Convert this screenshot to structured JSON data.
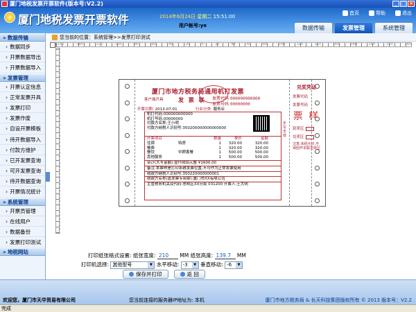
{
  "window": {
    "title": "厦门地税发票开票软件(版本号:V2.2)",
    "min": "_",
    "max": "□",
    "close": "×"
  },
  "header": {
    "app_title": "厦门地税发票开票软件",
    "date": "2014年6月24日",
    "weekday": "星期二",
    "time": "15:51:00",
    "account_label": "用户帐号:ye",
    "links": [
      "首页",
      "帮助",
      "退出"
    ],
    "tabs": [
      "数据传输",
      "发票管理",
      "系统管理"
    ],
    "active_tab": "发票管理"
  },
  "sidebar": {
    "groups": [
      {
        "title": "数据传输",
        "items": [
          "数据同步",
          "开票数据导出",
          "开票数据导入"
        ]
      },
      {
        "title": "发票管理",
        "items": [
          "开票认定信息",
          "正常发票开具",
          "发票打印",
          "发票作废",
          "自设开票模板",
          "待开数据导入",
          "付款方维护",
          "已开发票查询",
          "可开发票查询",
          "待开数据查询",
          "开票情况统计"
        ]
      },
      {
        "title": "系统管理",
        "items": [
          "开票员管理",
          "在线用户",
          "数据备份",
          "发票打印测试"
        ]
      },
      {
        "title": "地税网站",
        "items": []
      }
    ]
  },
  "breadcrumb": "您当前的位置：系统管理>>发票打印测试",
  "ruler": {
    "marks": [
      "-150",
      "-140",
      "-120",
      "-100",
      "-80",
      "-60",
      "-40",
      "-20",
      "0",
      "20",
      "40",
      "60",
      "80",
      "100",
      "120",
      "140",
      "160",
      "180",
      "200",
      "220",
      "240"
    ]
  },
  "invoice": {
    "title": "厦门市地方税务局通用机打发票",
    "subtitle": "发 票 联",
    "code_label": "发票代码",
    "code": "000000000000",
    "number_label": "发票号码",
    "number": "00000000",
    "customer_label": "客户端开具",
    "date_label": "开票日期:",
    "date": "2013-07-01",
    "industry_label": "行业分类:",
    "industry": "服务业",
    "lines": [
      "机打代码:000000000000",
      "机打号码:00000000",
      "付款方名称:王小明",
      "付款方纳税人识别号:350200000000000000"
    ],
    "items_header": [
      "开票项目",
      "",
      "数量",
      "单价",
      "金额"
    ],
    "items": [
      [
        "住宿",
        "特房",
        "1",
        "320.00",
        "320.00"
      ],
      [
        "餐费",
        "",
        "1",
        "320.00",
        "320.00"
      ],
      [
        "餐饮",
        "中顾客餐",
        "1",
        "500.00",
        "500.00"
      ],
      [
        "其他服务",
        "",
        "1",
        "500.00",
        "500.00"
      ]
    ],
    "total_line": "合计(大写金额):壹仟陆佰元整    ¥1600.00",
    "notes": [
      "备注:本票样是打印系统发票位置,不可作为正常发票使用",
      "收款方纳税人识别号:350220000000001",
      "收款方名称(盖发票专用章):厦门市XX有限公司",
      "主管税务机关及代码:思明区XX分局 031200    开票人:王大明"
    ],
    "side_note": "手写无效"
  },
  "stub": {
    "title": "兑奖凭证",
    "code_label": "发票代码",
    "number_label": "发票号码",
    "watermark": "票 样",
    "prize_label": "刮奖区",
    "award_label": "兑奖区",
    "note": "注意:未经允许,不得刮开本联兑奖区"
  },
  "settings": {
    "paper_label": "打印纸张格式设置:",
    "width_label": "纸张宽度:",
    "width_value": "210",
    "unit1": "MM",
    "height_label": "纸张高度:",
    "height_value": "139.7",
    "unit2": "MM",
    "printer_label": "打印机选择:",
    "printer_value": "其他型号",
    "hmove_label": "水平移动:",
    "hmove_value": "-3",
    "vmove_label": "垂直移动:",
    "vmove_value": "-6",
    "save_label": "保存并打印",
    "back_label": "返 回"
  },
  "footer": {
    "welcome": "欢迎您，厦门市天华贸易有限公司",
    "server": "您当前连接的服务器IP地址为: 本机",
    "copyright": "厦门市地方税务局 & 长天科技集团版权所有 © 2013 版本号：V2.2"
  },
  "status": "完成"
}
